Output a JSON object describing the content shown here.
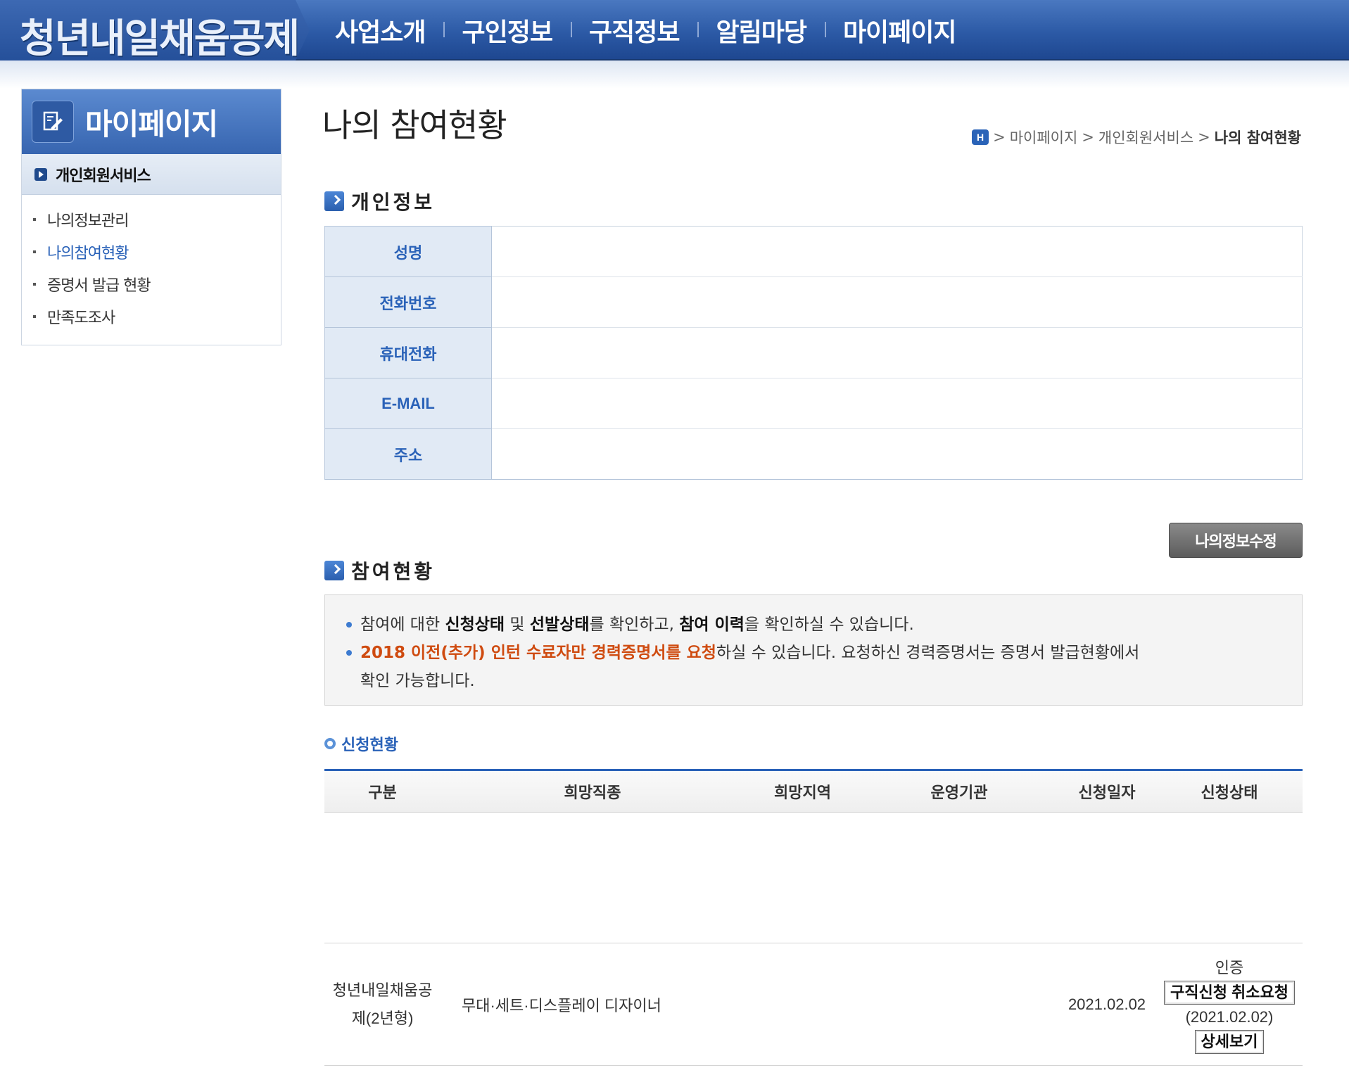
{
  "header": {
    "logo": "청년내일채움공제",
    "nav": [
      "사업소개",
      "구인정보",
      "구직정보",
      "알림마당",
      "마이페이지"
    ]
  },
  "sidebar": {
    "title": "마이페이지",
    "section": "개인회원서비스",
    "items": [
      {
        "label": "나의정보관리",
        "active": false
      },
      {
        "label": "나의참여현황",
        "active": true
      },
      {
        "label": "증명서 발급 현황",
        "active": false
      },
      {
        "label": "만족도조사",
        "active": false
      }
    ]
  },
  "page": {
    "title": "나의 참여현황",
    "breadcrumb": [
      "마이페이지",
      "개인회원서비스",
      "나의 참여현황"
    ]
  },
  "personal_info": {
    "section_title": "개인정보",
    "labels": [
      "성명",
      "전화번호",
      "휴대전화",
      "E-MAIL",
      "주소"
    ],
    "edit_button": "나의정보수정"
  },
  "participation": {
    "section_title": "참여현황",
    "notice": {
      "line1": {
        "t1": "참여에 대한 ",
        "b1": "신청상태",
        "t2": " 및 ",
        "b2": "선발상태",
        "t3": "를 확인하고, ",
        "b3": "참여 이력",
        "t4": "을 확인하실 수 있습니다."
      },
      "line2": {
        "highlight": "2018 이전(추가) 인턴 수료자만 경력증명서를 요청",
        "rest": "하실 수 있습니다. 요청하신 경력증명서는 증명서 발급현황에서",
        "cont": "확인 가능합니다."
      }
    },
    "sub_title": "신청현황",
    "columns": [
      "구분",
      "희망직종",
      "희망지역",
      "운영기관",
      "신청일자",
      "신청상태"
    ],
    "rows": [
      {
        "category_line1": "청년내일채움공",
        "category_line2": "제(2년형)",
        "job": "무대·세트·디스플레이 디자이너",
        "region": "",
        "agency": "",
        "date": "2021.02.02",
        "status": "인증",
        "cancel_button": "구직신청 취소요청",
        "status_date": "(2021.02.02)",
        "detail_button": "상세보기"
      }
    ]
  },
  "colors": {
    "header_blue": "#2c5aa6",
    "accent_blue": "#2a62b8",
    "notice_orange": "#cf4b10"
  }
}
